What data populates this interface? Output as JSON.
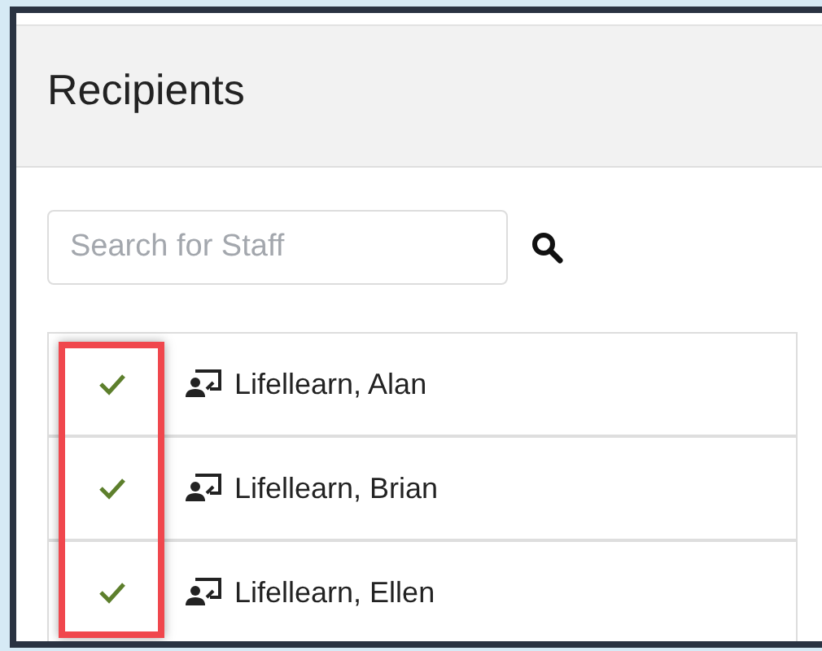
{
  "panel": {
    "title": "Recipients"
  },
  "search": {
    "placeholder": "Search for Staff"
  },
  "recipients": [
    {
      "name": "Lifellearn, Alan",
      "checked": true
    },
    {
      "name": "Lifellearn, Brian",
      "checked": true
    },
    {
      "name": "Lifellearn, Ellen",
      "checked": true
    }
  ],
  "highlight": {
    "kind": "check-column"
  }
}
